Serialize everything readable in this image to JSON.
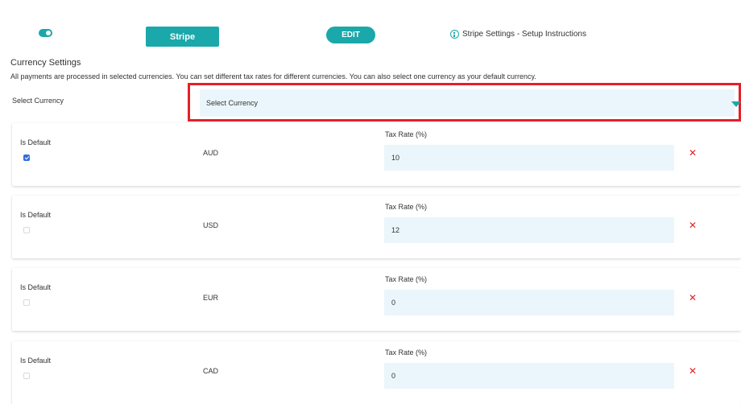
{
  "header": {
    "toggle_on": true,
    "stripe_button": "Stripe",
    "edit_button": "EDIT",
    "instructions_link": "Stripe Settings - Setup Instructions"
  },
  "currency_settings": {
    "title": "Currency Settings",
    "description": "All payments are processed in selected currencies. You can set different tax rates for different currencies. You can also select one currency as your default currency.",
    "select_label": "Select Currency",
    "select_value": "Select Currency"
  },
  "currencies": [
    {
      "is_default_label": "Is Default",
      "is_default": true,
      "code": "AUD",
      "tax_label": "Tax Rate (%)",
      "tax_rate": "10"
    },
    {
      "is_default_label": "Is Default",
      "is_default": false,
      "code": "USD",
      "tax_label": "Tax Rate (%)",
      "tax_rate": "12"
    },
    {
      "is_default_label": "Is Default",
      "is_default": false,
      "code": "EUR",
      "tax_label": "Tax Rate (%)",
      "tax_rate": "0"
    },
    {
      "is_default_label": "Is Default",
      "is_default": false,
      "code": "CAD",
      "tax_label": "Tax Rate (%)",
      "tax_rate": "0"
    }
  ],
  "colors": {
    "accent": "#1aa8aa",
    "highlight_border": "#e4202a",
    "field_bg": "#eaf6fb",
    "checkbox_checked": "#2f6fdb"
  }
}
